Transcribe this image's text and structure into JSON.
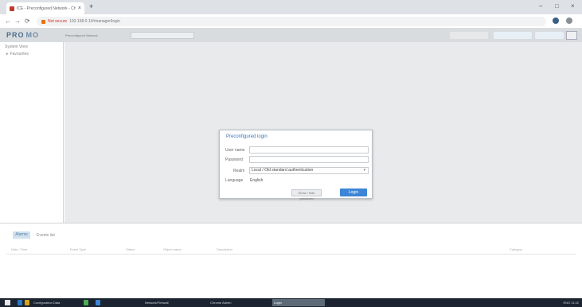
{
  "browser": {
    "tab_title": "ICE - Preconfigured Network - Chrome",
    "tab_close": "×",
    "new_tab": "+",
    "win_min": "–",
    "win_max": "□",
    "win_close": "×",
    "nav_back": "←",
    "nav_forward": "→",
    "nav_reload": "⟳",
    "url_warning": "Not secure",
    "url": "192.168.0.1/#/manager/login"
  },
  "app": {
    "logo_text": "PRO",
    "logo_text2": "MO",
    "logo_sub": "Preconfigured Network",
    "left_title": "System View",
    "tree_item": "Favourites"
  },
  "bottom": {
    "active_tab": "Alarms",
    "tab2": "Events list",
    "columns": [
      "Date / Time",
      "Event Type",
      "Status",
      "Object name",
      "Description",
      "Category"
    ]
  },
  "login": {
    "title": "Preconfigured login",
    "user_label": "User name",
    "user_value": "",
    "password_label": "Password",
    "password_value": "",
    "realm_label": "Realm",
    "realm_value": "Local / Old standard authentication",
    "language_label": "Language",
    "language_value": "English",
    "show_pwd_label": "Show / hide password",
    "login_button": "Login"
  },
  "taskbar": {
    "items": [
      "Configuration Data",
      "Network/Firewall",
      "Chrome Admin",
      "Login"
    ],
    "tray": "ENG 11:42"
  }
}
